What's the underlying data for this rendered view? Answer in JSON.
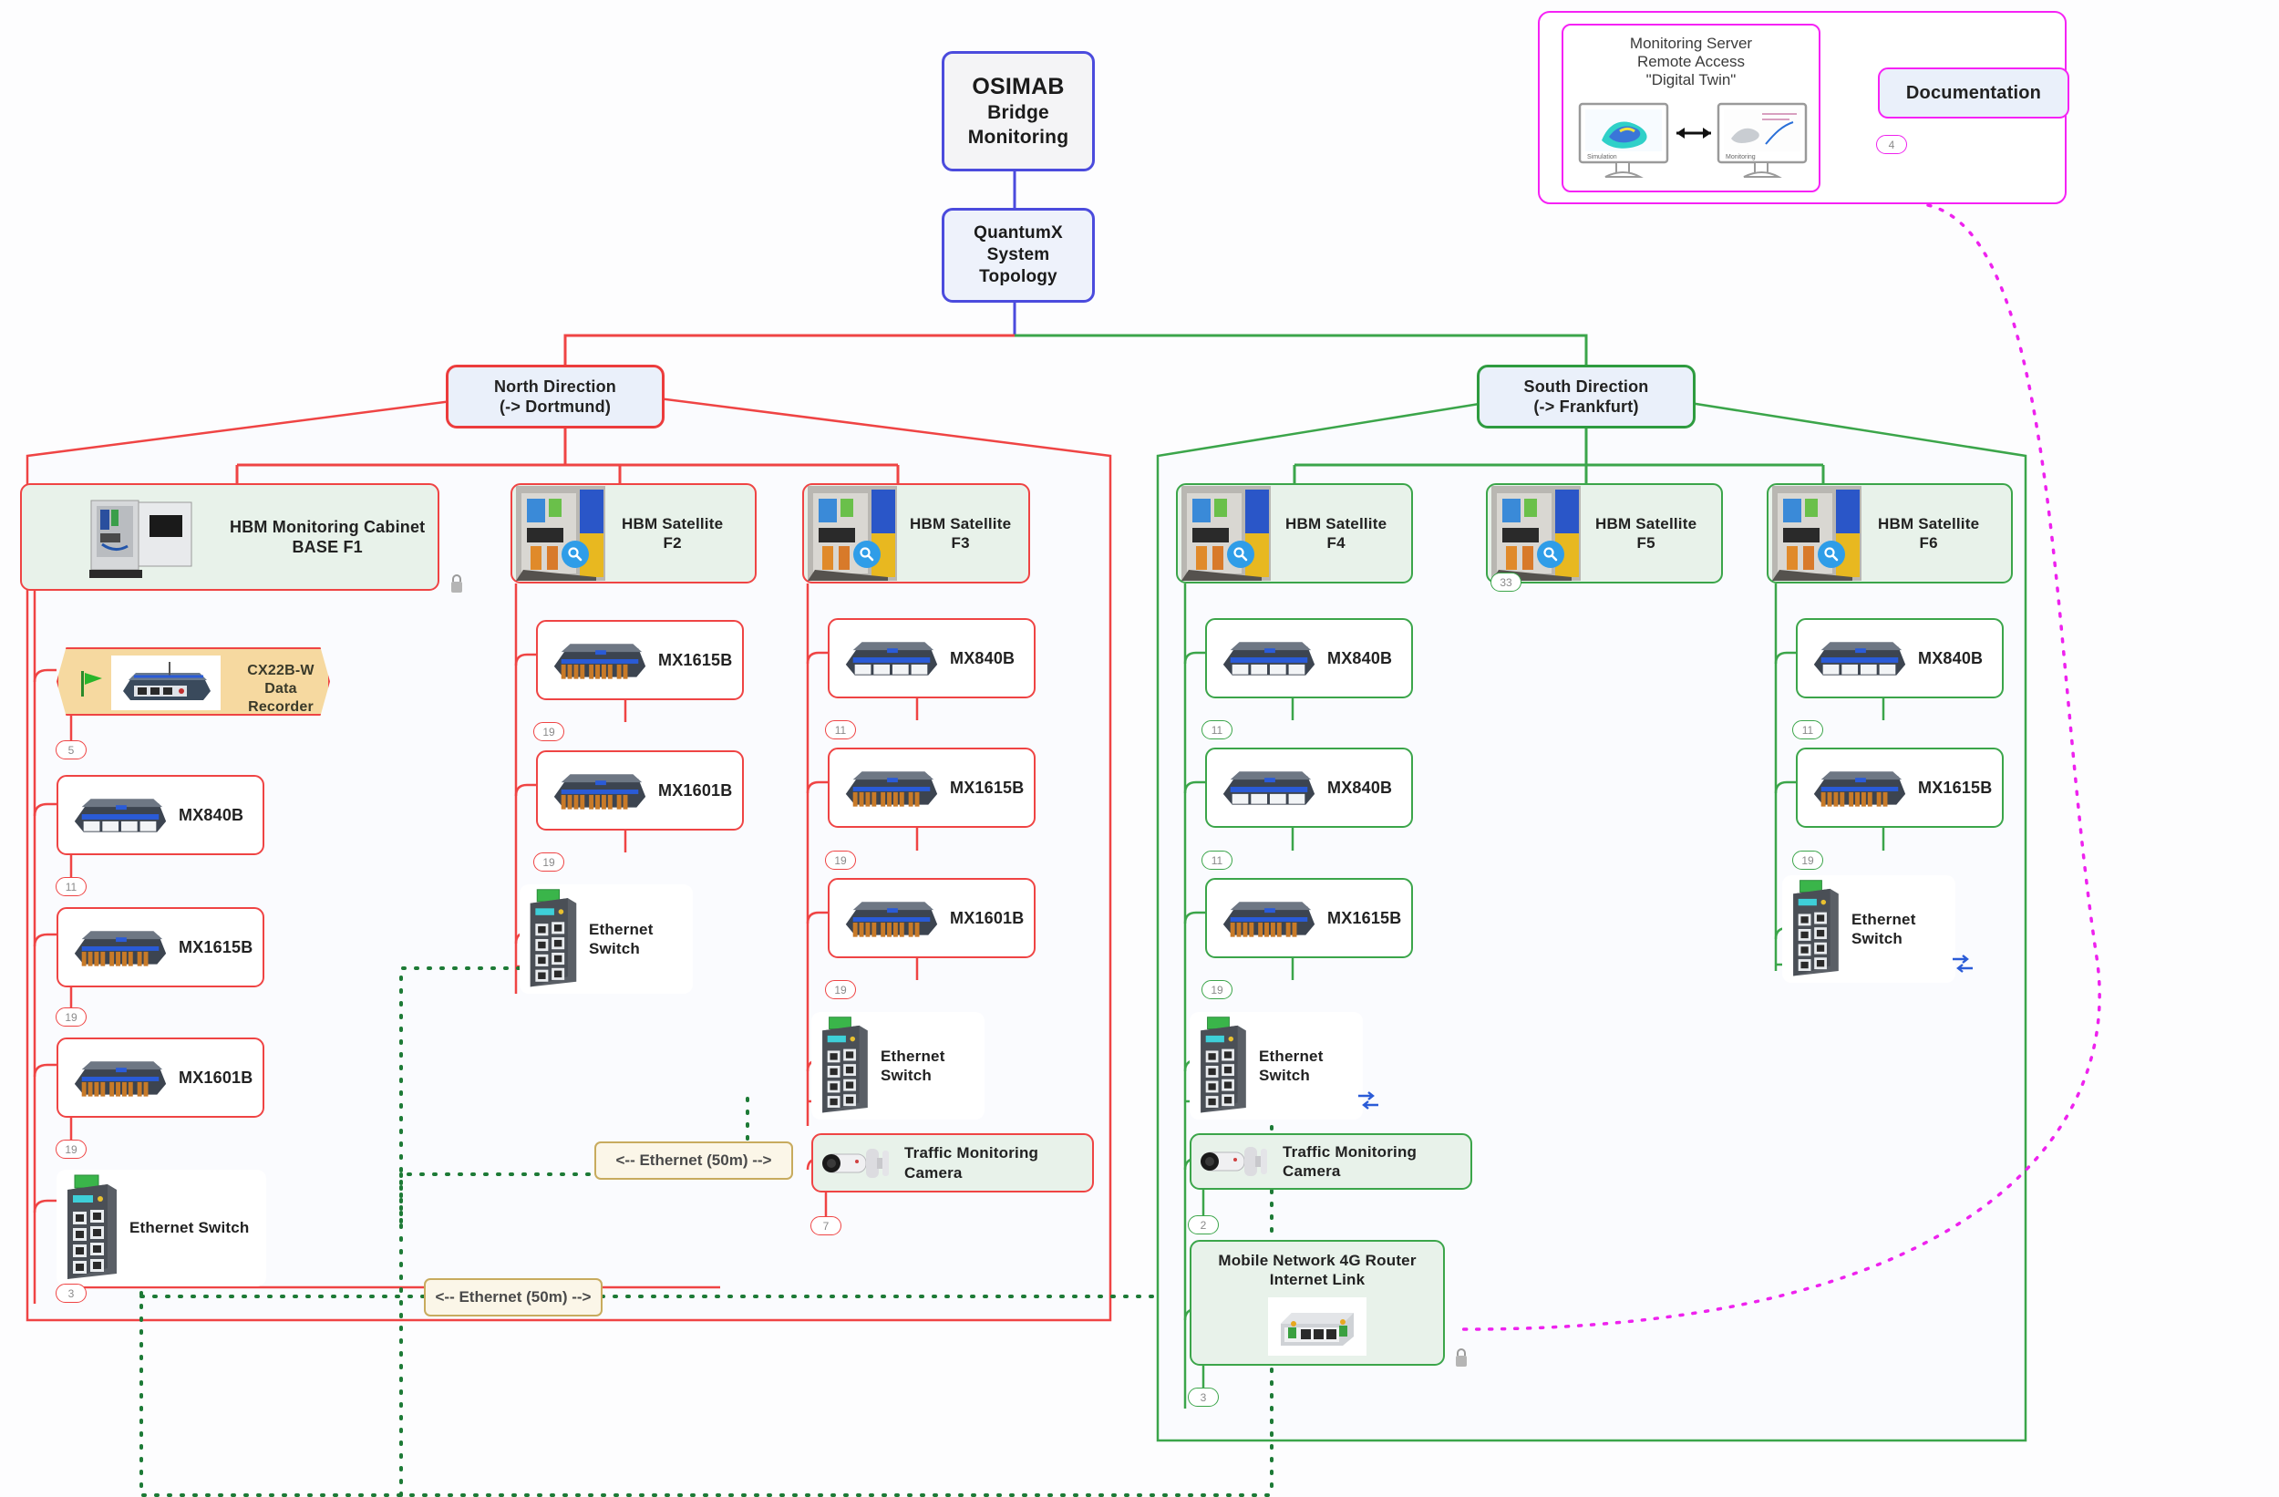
{
  "title": {
    "root": "OSIMAB\nBridge\nMonitoring",
    "root_line1": "OSIMAB",
    "root_line2": "Bridge",
    "root_line3": "Monitoring",
    "sub_line1": "QuantumX",
    "sub_line2": "System",
    "sub_line3": "Topology"
  },
  "monitoring_server": {
    "line1": "Monitoring Server",
    "line2": "Remote Access",
    "line3": "\"Digital Twin\"",
    "screen_left_caption": "Simulation",
    "screen_right_caption": "Monitoring",
    "documentation_label": "Documentation",
    "documentation_badge": "4"
  },
  "north": {
    "header_line1": "North Direction",
    "header_line2": "(-> Dortmund)",
    "color": "#ef4444",
    "cabinet": {
      "line1": "HBM Monitoring Cabinet",
      "line2": "BASE F1"
    },
    "recorder": {
      "line1": "CX22B-W",
      "line2": "Data Recorder",
      "badge": "5"
    },
    "f1_devices": [
      {
        "label": "MX840B",
        "badge": "11"
      },
      {
        "label": "MX1615B",
        "badge": "19"
      },
      {
        "label": "MX1601B",
        "badge": "19"
      },
      {
        "label": "Ethernet Switch",
        "badge": "3"
      }
    ],
    "f2": {
      "title_line1": "HBM Satellite",
      "title_line2": "F2",
      "devices": [
        {
          "label": "MX1615B",
          "badge": "19"
        },
        {
          "label": "MX1601B",
          "badge": "19"
        },
        {
          "label": "Ethernet Switch",
          "badge": ""
        }
      ]
    },
    "f3": {
      "title_line1": "HBM Satellite",
      "title_line2": "F3",
      "devices": [
        {
          "label": "MX840B",
          "badge": "11"
        },
        {
          "label": "MX1615B",
          "badge": "19"
        },
        {
          "label": "MX1601B",
          "badge": "19"
        },
        {
          "label": "Ethernet Switch",
          "badge": ""
        },
        {
          "label": "Traffic Monitoring Camera",
          "badge": "7"
        }
      ]
    },
    "ethernet_note_upper": "<-- Ethernet (50m) -->",
    "ethernet_note_lower": "<-- Ethernet (50m) -->"
  },
  "south": {
    "header_line1": "South Direction",
    "header_line2": "(-> Frankfurt)",
    "color": "#3ba54a",
    "f4": {
      "title_line1": "HBM Satellite",
      "title_line2": "F4",
      "devices": [
        {
          "label": "MX840B",
          "badge": "11"
        },
        {
          "label": "MX840B",
          "badge": "11"
        },
        {
          "label": "MX1615B",
          "badge": "19"
        },
        {
          "label": "Ethernet Switch",
          "badge": ""
        },
        {
          "label": "Traffic Monitoring Camera",
          "badge": "2"
        }
      ],
      "router": {
        "line1": "Mobile Network 4G Router",
        "line2": "Internet Link",
        "badge": "3"
      }
    },
    "f5": {
      "title_line1": "HBM Satellite",
      "title_line2": "F5",
      "badge": "33"
    },
    "f6": {
      "title_line1": "HBM Satellite",
      "title_line2": "F6",
      "devices": [
        {
          "label": "MX840B",
          "badge": "11"
        },
        {
          "label": "MX1615B",
          "badge": "19"
        },
        {
          "label": "Ethernet Switch",
          "badge": ""
        }
      ]
    }
  },
  "colors": {
    "north": "#ef4444",
    "south": "#3ba54a",
    "root": "#4b4bdd",
    "server": "#f522f5",
    "ethernet_dotted": "#1d7a36",
    "note_border": "#c8ab5e"
  }
}
